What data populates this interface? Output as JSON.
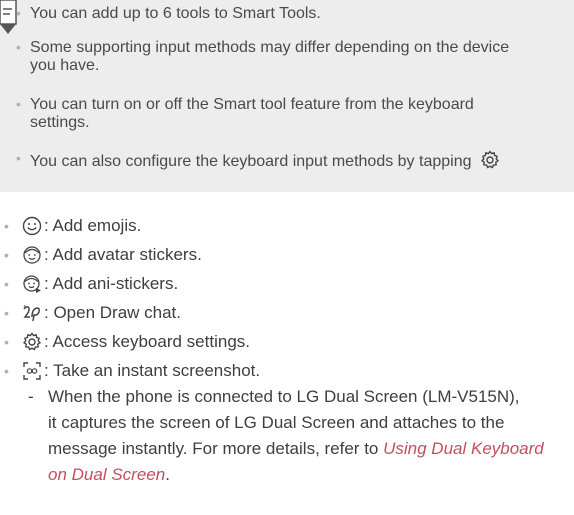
{
  "note": {
    "items": [
      {
        "lines": [
          "You can add up to 6 tools to Smart Tools."
        ]
      },
      {
        "lines": [
          "Some supporting input methods may differ depending on the device",
          "you have."
        ]
      },
      {
        "lines": [
          "You can turn on or off the Smart tool feature from the keyboard",
          "settings."
        ]
      },
      {
        "lines": [
          "You can also configure the keyboard input methods by tapping"
        ]
      }
    ]
  },
  "tools": [
    {
      "icon": "emoji-icon",
      "text": ": Add emojis."
    },
    {
      "icon": "avatar-sticker-icon",
      "text": ": Add avatar stickers."
    },
    {
      "icon": "ani-sticker-icon",
      "text": ": Add ani-stickers."
    },
    {
      "icon": "draw-chat-icon",
      "text": ": Open Draw chat."
    },
    {
      "icon": "settings-gear-icon",
      "text": ": Access keyboard settings."
    },
    {
      "icon": "screenshot-icon",
      "text": ": Take an instant screenshot."
    }
  ],
  "sub_note": {
    "line1": "When the phone is connected to LG Dual Screen (LM-V515N),",
    "line2": "it captures the screen of LG Dual Screen and attaches to the",
    "line3_text": "message instantly. For more details, refer to ",
    "line3_link": "Using Dual Keyboard",
    "line4_link": "on Dual Screen",
    "line4_end": "."
  }
}
